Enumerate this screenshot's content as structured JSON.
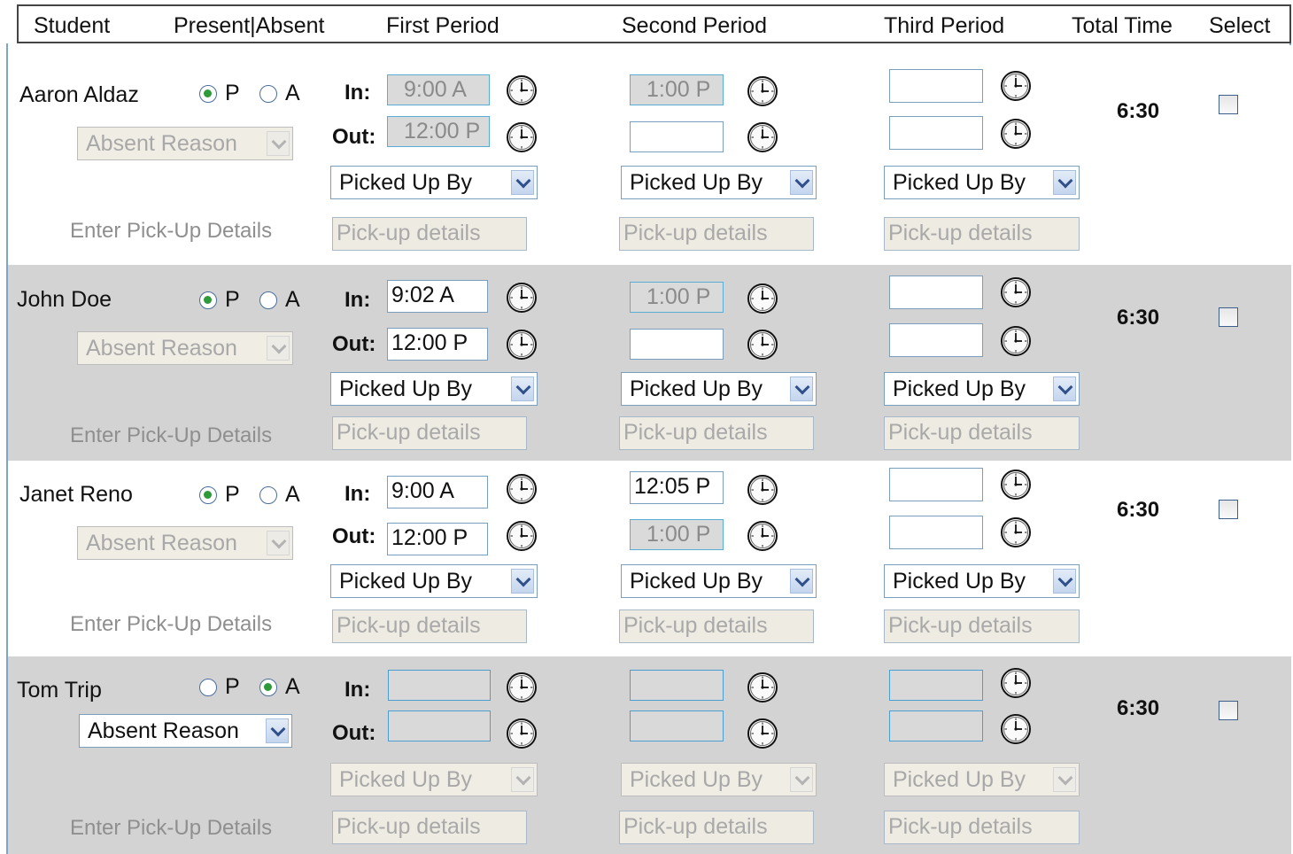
{
  "header": {
    "student": "Student",
    "present_absent": "Present|Absent",
    "first_period": "First Period",
    "second_period": "Second Period",
    "third_period": "Third Period",
    "total_time": "Total Time",
    "select": "Select"
  },
  "labels": {
    "present": "P",
    "absent": "A",
    "in": "In:",
    "out": "Out:",
    "absent_reason": "Absent Reason",
    "picked_up_by": "Picked Up By",
    "enter_pickup_details": "Enter Pick-Up Details",
    "pickup_placeholder": "Pick-up details"
  },
  "students": [
    {
      "name": "Aaron Aldaz",
      "status": "P",
      "p1_in": "9:00 A",
      "p1_out": "12:00 P",
      "p2_in": "1:00 P",
      "p2_out": "",
      "p3_in": "",
      "p3_out": "",
      "total": "6:30"
    },
    {
      "name": "John Doe",
      "status": "P",
      "p1_in": "9:02 A",
      "p1_out": "12:00 P",
      "p2_in": "1:00 P",
      "p2_out": "",
      "p3_in": "",
      "p3_out": "",
      "total": "6:30"
    },
    {
      "name": "Janet Reno",
      "status": "P",
      "p1_in": "9:00 A",
      "p1_out": "12:00 P",
      "p2_in": "12:05 P",
      "p2_out": "1:00 P",
      "p3_in": "",
      "p3_out": "",
      "total": "6:30"
    },
    {
      "name": "Tom Trip",
      "status": "A",
      "p1_in": "",
      "p1_out": "",
      "p2_in": "",
      "p2_out": "",
      "p3_in": "",
      "p3_out": "",
      "total": "6:30"
    }
  ],
  "icons": {
    "clock": "clock-icon",
    "checkbox": "checkbox",
    "dropdown": "chevron-down-icon"
  },
  "colors": {
    "row_alt": "#d3d3d3",
    "radio_selected": "#2e9a3a",
    "input_border": "#7b9ebd",
    "readonly_border": "#5aaed6"
  }
}
